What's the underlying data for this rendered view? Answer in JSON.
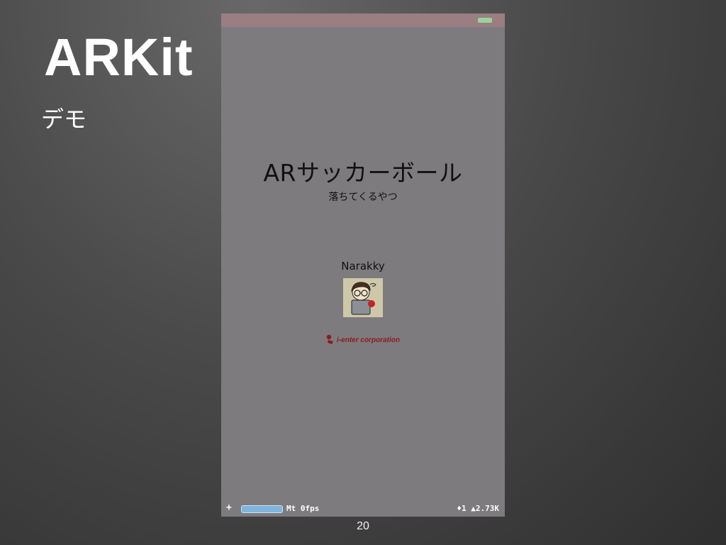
{
  "slide": {
    "title": "ARKit",
    "subtitle": "デモ",
    "page_number": "20"
  },
  "app": {
    "title": "ARサッカーボール",
    "subtitle": "落ちてくるやつ",
    "author": "Narakky",
    "company": "i-enter corporation",
    "colors": {
      "screen_bg": "#7d7b7e",
      "status_bar": "#9a7e82",
      "battery": "#9ad39a",
      "logo": "#8a1b22"
    }
  },
  "debug": {
    "add_icon": "+",
    "fps_label": "Mt 0fps",
    "stats": "♦1 ▲2.73K"
  }
}
